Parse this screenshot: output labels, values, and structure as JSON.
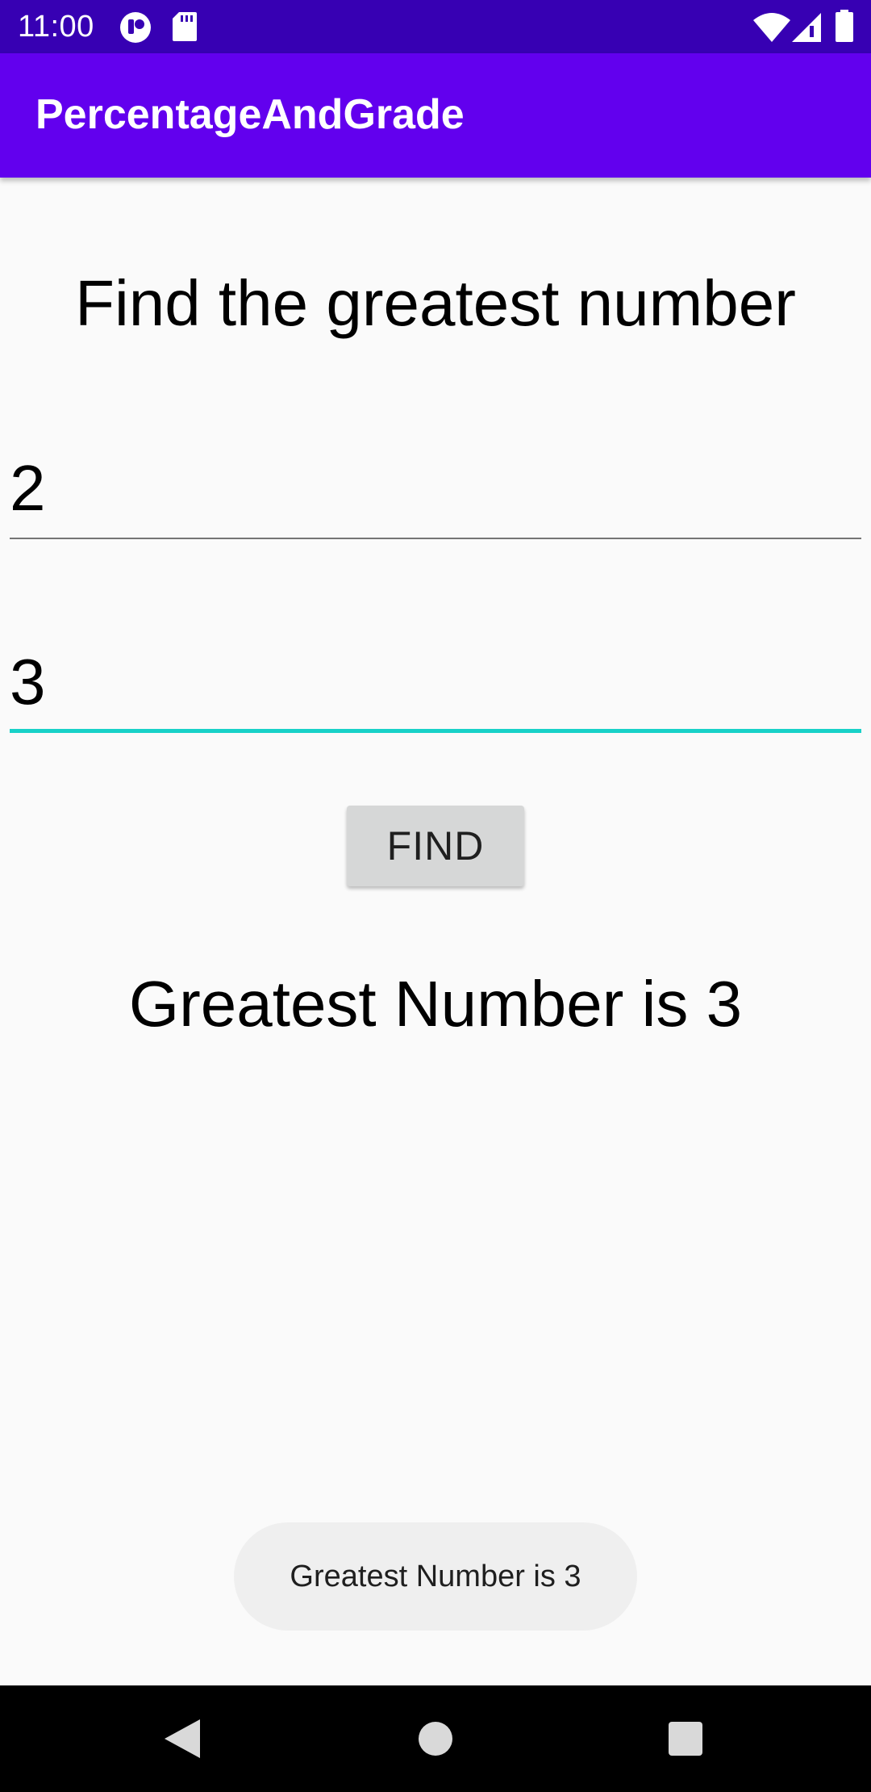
{
  "status_bar": {
    "time": "11:00",
    "left_icons": [
      "notification-app-icon",
      "sd-card-icon"
    ],
    "right_icons": [
      "wifi-icon",
      "cell-signal-icon",
      "battery-icon"
    ]
  },
  "app_bar": {
    "title": "PercentageAndGrade",
    "color": "#6200EE"
  },
  "main": {
    "headline": "Find the greatest number",
    "input_1": {
      "value": "2"
    },
    "input_2": {
      "value": "3",
      "focused": true,
      "accent": "#18D1C8"
    },
    "find_button_label": "FIND",
    "result": "Greatest Number is 3"
  },
  "toast": {
    "message": "Greatest Number is 3"
  },
  "nav_bar": {
    "icons": [
      "back-icon",
      "home-icon",
      "recents-icon"
    ]
  }
}
